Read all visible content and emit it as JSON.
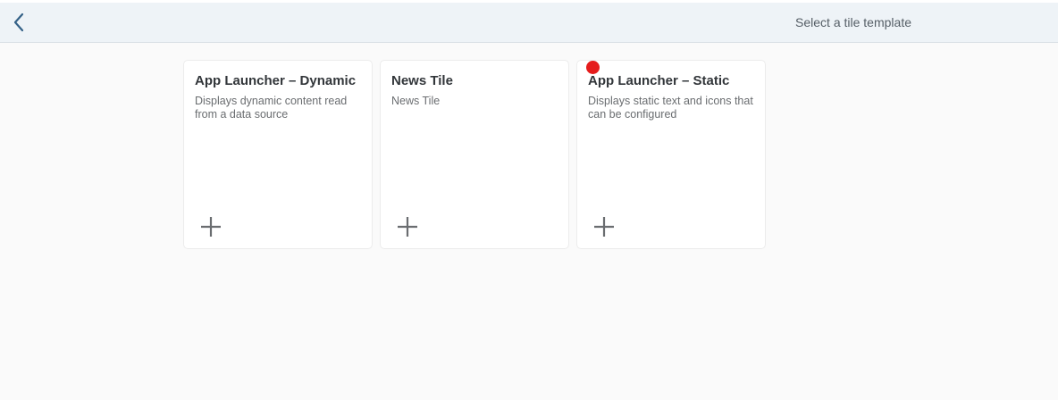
{
  "header": {
    "title": "Select a tile template",
    "back_icon": "chevron-left-icon"
  },
  "tiles": [
    {
      "title": "App Launcher – Dynamic",
      "subtitle": "Displays dynamic content read from a data source",
      "icon": "plus-icon"
    },
    {
      "title": "News Tile",
      "subtitle": "News Tile",
      "icon": "plus-icon"
    },
    {
      "title": "App Launcher – Static",
      "subtitle": "Displays static text and icons that can be configured",
      "icon": "plus-icon"
    }
  ],
  "colors": {
    "header_background": "#eef3f7",
    "page_background": "#fafafa",
    "accent": "#346187",
    "marker": "#e51c1c"
  }
}
